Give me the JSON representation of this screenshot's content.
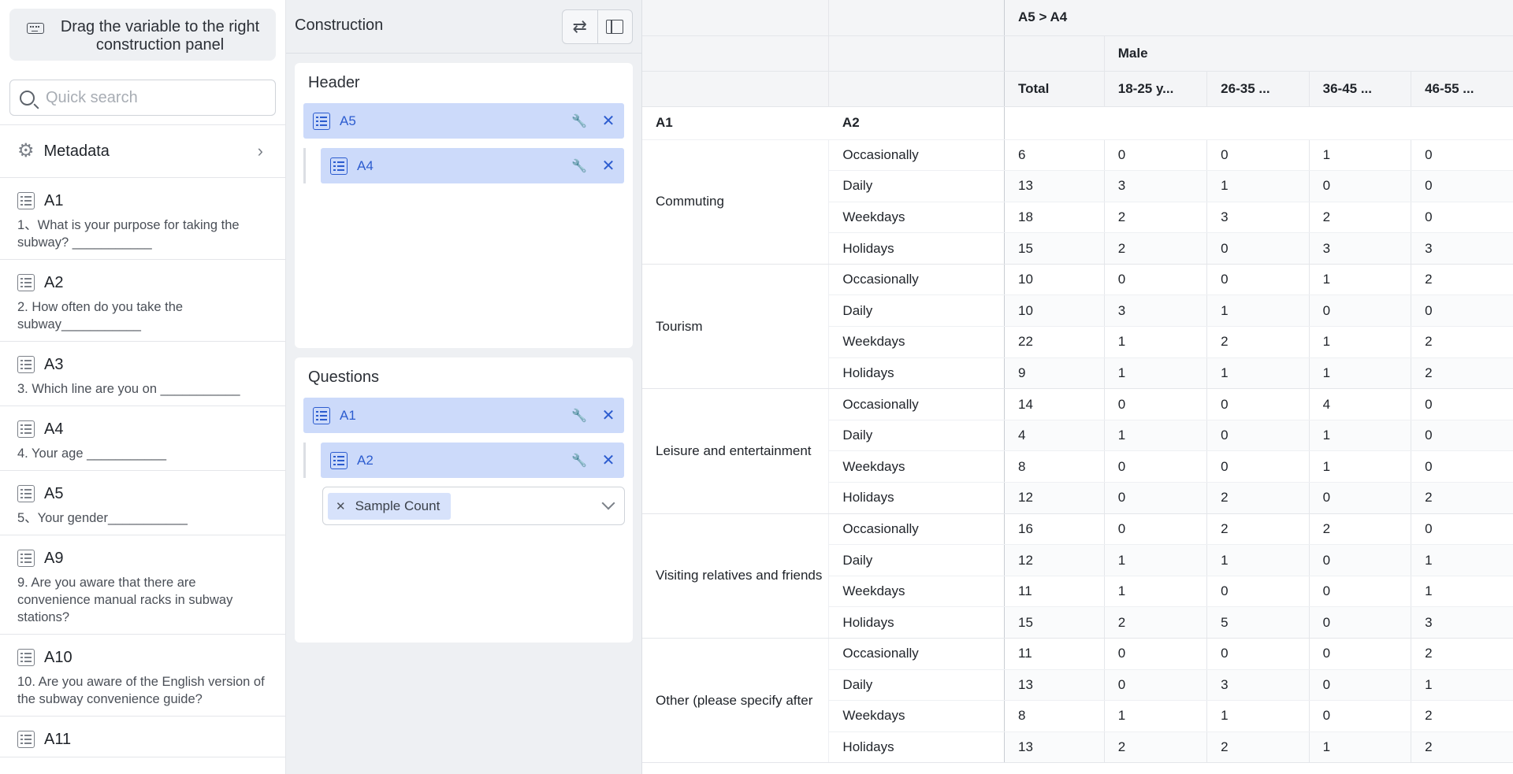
{
  "left": {
    "drag_hint": "Drag the variable to the right construction panel",
    "search_placeholder": "Quick search",
    "metadata_label": "Metadata",
    "variables": [
      {
        "code": "A1",
        "desc": "1、What is your purpose for taking the subway? ___________"
      },
      {
        "code": "A2",
        "desc": "2. How often do you take the subway___________"
      },
      {
        "code": "A3",
        "desc": "3. Which line are you on ___________"
      },
      {
        "code": "A4",
        "desc": "4. Your age ___________"
      },
      {
        "code": "A5",
        "desc": "5、Your gender___________"
      },
      {
        "code": "A9",
        "desc": "9. Are you aware that there are convenience manual racks in subway stations?"
      },
      {
        "code": "A10",
        "desc": "10. Are you aware of the English version of the subway convenience guide?"
      },
      {
        "code": "A11",
        "desc": ""
      }
    ]
  },
  "mid": {
    "title": "Construction",
    "header_title": "Header",
    "header_chips": [
      "A5",
      "A4"
    ],
    "questions_title": "Questions",
    "question_chips": [
      "A1",
      "A2"
    ],
    "statistic_tag": "Sample Count"
  },
  "table": {
    "banner": "A5 > A4",
    "gender": "Male",
    "col_total": "Total",
    "age_cols": [
      "18-25 y...",
      "26-35 ...",
      "36-45 ...",
      "46-55 ..."
    ],
    "row_head_1": "A1",
    "row_head_2": "A2",
    "groups": [
      {
        "name": "Commuting",
        "rows": [
          {
            "freq": "Occasionally",
            "vals": [
              "6",
              "0",
              "0",
              "1",
              "0"
            ]
          },
          {
            "freq": "Daily",
            "vals": [
              "13",
              "3",
              "1",
              "0",
              "0"
            ]
          },
          {
            "freq": "Weekdays",
            "vals": [
              "18",
              "2",
              "3",
              "2",
              "0"
            ]
          },
          {
            "freq": "Holidays",
            "vals": [
              "15",
              "2",
              "0",
              "3",
              "3"
            ]
          }
        ]
      },
      {
        "name": "Tourism",
        "rows": [
          {
            "freq": "Occasionally",
            "vals": [
              "10",
              "0",
              "0",
              "1",
              "2"
            ]
          },
          {
            "freq": "Daily",
            "vals": [
              "10",
              "3",
              "1",
              "0",
              "0"
            ]
          },
          {
            "freq": "Weekdays",
            "vals": [
              "22",
              "1",
              "2",
              "1",
              "2"
            ]
          },
          {
            "freq": "Holidays",
            "vals": [
              "9",
              "1",
              "1",
              "1",
              "2"
            ]
          }
        ]
      },
      {
        "name": "Leisure and entertainment",
        "rows": [
          {
            "freq": "Occasionally",
            "vals": [
              "14",
              "0",
              "0",
              "4",
              "0"
            ]
          },
          {
            "freq": "Daily",
            "vals": [
              "4",
              "1",
              "0",
              "1",
              "0"
            ]
          },
          {
            "freq": "Weekdays",
            "vals": [
              "8",
              "0",
              "0",
              "1",
              "0"
            ]
          },
          {
            "freq": "Holidays",
            "vals": [
              "12",
              "0",
              "2",
              "0",
              "2"
            ]
          }
        ]
      },
      {
        "name": "Visiting relatives and friends",
        "rows": [
          {
            "freq": "Occasionally",
            "vals": [
              "16",
              "0",
              "2",
              "2",
              "0"
            ]
          },
          {
            "freq": "Daily",
            "vals": [
              "12",
              "1",
              "1",
              "0",
              "1"
            ]
          },
          {
            "freq": "Weekdays",
            "vals": [
              "11",
              "1",
              "0",
              "0",
              "1"
            ]
          },
          {
            "freq": "Holidays",
            "vals": [
              "15",
              "2",
              "5",
              "0",
              "3"
            ]
          }
        ]
      },
      {
        "name": "Other (please specify after",
        "rows": [
          {
            "freq": "Occasionally",
            "vals": [
              "11",
              "0",
              "0",
              "0",
              "2"
            ]
          },
          {
            "freq": "Daily",
            "vals": [
              "13",
              "0",
              "3",
              "0",
              "1"
            ]
          },
          {
            "freq": "Weekdays",
            "vals": [
              "8",
              "1",
              "1",
              "0",
              "2"
            ]
          },
          {
            "freq": "Holidays",
            "vals": [
              "13",
              "2",
              "2",
              "1",
              "2"
            ]
          }
        ]
      }
    ]
  }
}
